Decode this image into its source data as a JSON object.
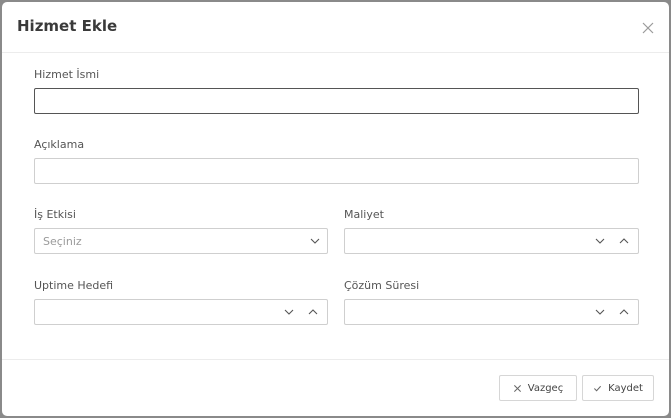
{
  "modal": {
    "title": "Hizmet Ekle"
  },
  "form": {
    "service_name": {
      "label": "Hizmet İsmi",
      "value": ""
    },
    "description": {
      "label": "Açıklama",
      "value": ""
    },
    "business_impact": {
      "label": "İş Etkisi",
      "placeholder": "Seçiniz"
    },
    "cost": {
      "label": "Maliyet",
      "value": ""
    },
    "uptime_target": {
      "label": "Uptime Hedefi",
      "value": ""
    },
    "resolution_time": {
      "label": "Çözüm Süresi",
      "value": ""
    }
  },
  "footer": {
    "cancel_label": "Vazgeç",
    "save_label": "Kaydet"
  },
  "icons": {
    "close": "close-icon",
    "chevron_down": "chevron-down-icon",
    "chevron_up": "chevron-up-icon",
    "check": "check-icon"
  }
}
